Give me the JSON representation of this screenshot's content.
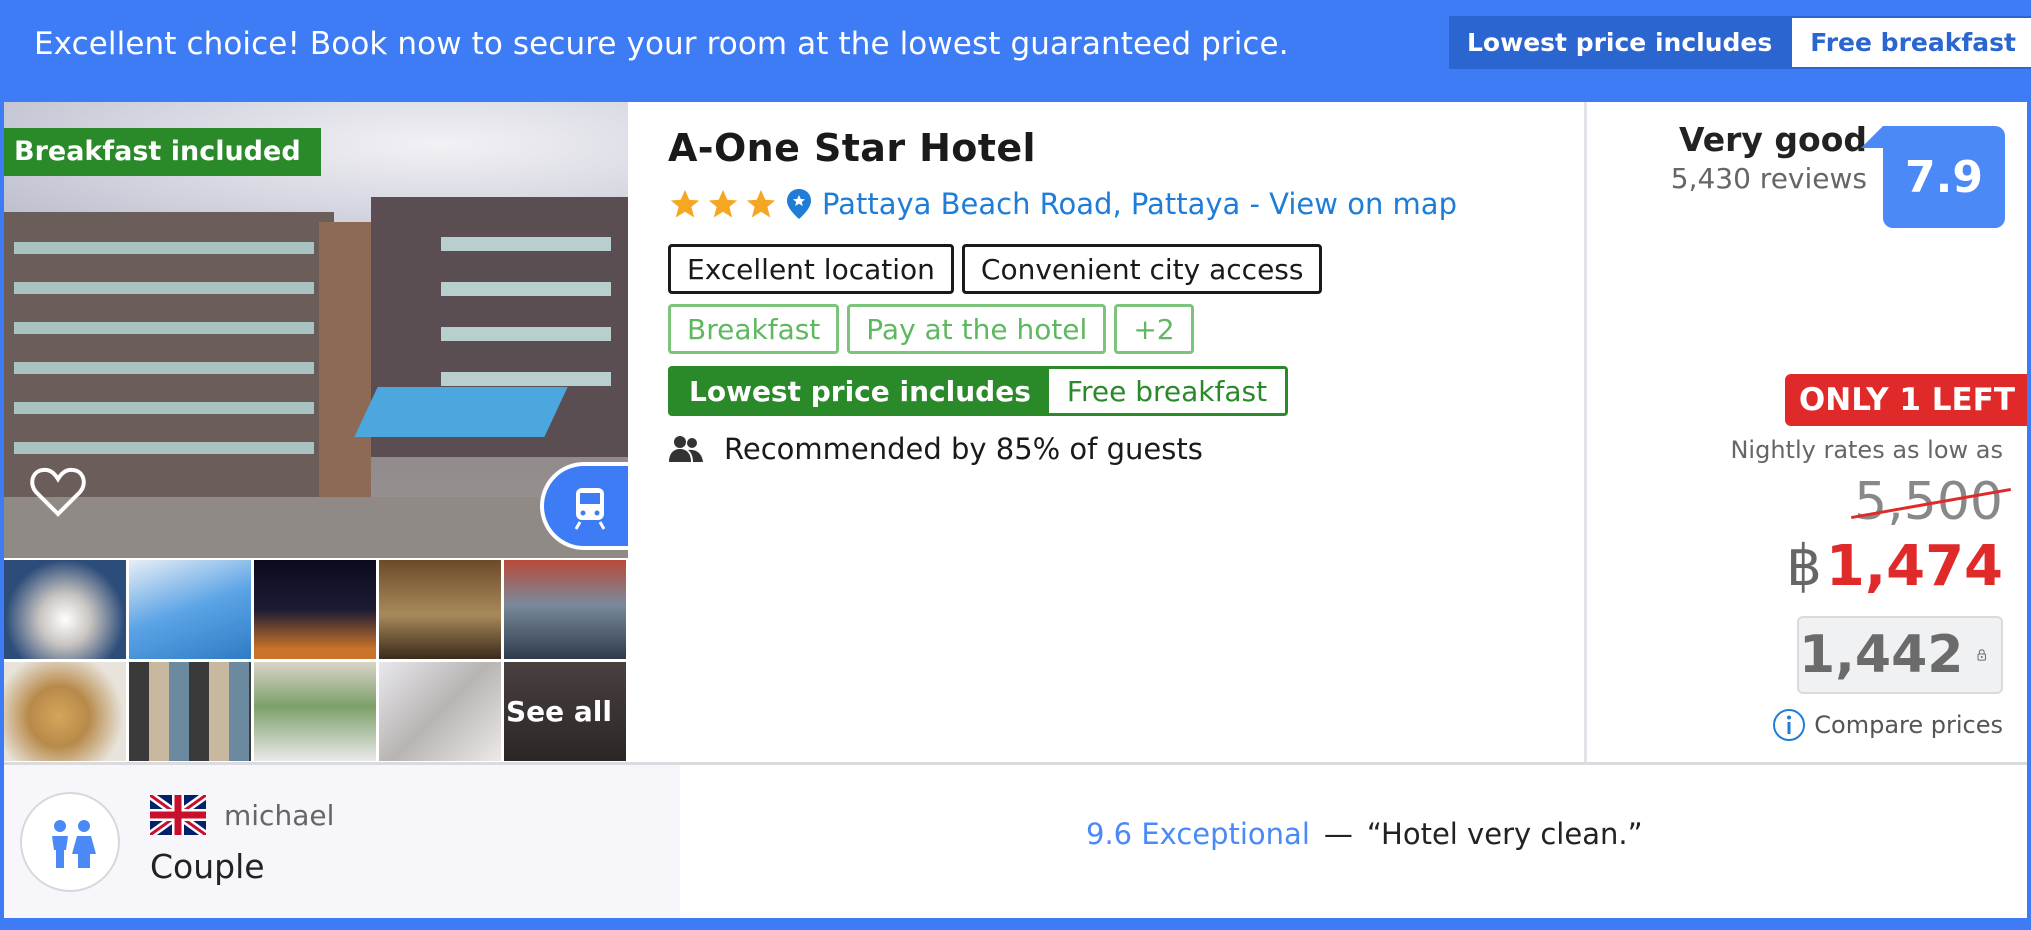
{
  "banner": {
    "message": "Excellent choice! Book now to secure your room at the lowest guaranteed price.",
    "badge_label": "Lowest price includes",
    "badge_value": "Free breakfast"
  },
  "photos": {
    "main_badge": "Breakfast included",
    "see_all": "See all",
    "icons": [
      "heart-icon",
      "train-icon"
    ]
  },
  "hotel": {
    "name": "A-One Star Hotel",
    "star_rating": 3,
    "location_text": "Pattaya Beach Road, Pattaya - View on map",
    "highlights": [
      "Excellent location",
      "Convenient city access"
    ],
    "amenities": [
      "Breakfast",
      "Pay at the hotel",
      "+2"
    ],
    "promo_label": "Lowest price includes",
    "promo_value": "Free breakfast",
    "recommendation": "Recommended by 85% of guests"
  },
  "rating": {
    "label": "Very good",
    "reviews": "5,430 reviews",
    "score": "7.9"
  },
  "pricing": {
    "availability": "ONLY 1 LEFT",
    "nightly_label": "Nightly rates as low as",
    "original_price": "5,500",
    "currency": "฿",
    "current_price": "1,474",
    "member_price": "1,442",
    "compare_label": "Compare prices"
  },
  "review": {
    "reviewer": "michael",
    "traveler_type": "Couple",
    "score_text": "9.6 Exceptional",
    "separator": "—",
    "quote": "“Hotel very clean.”"
  },
  "colors": {
    "brand_blue": "#3d7cf5",
    "green": "#2a8a2a",
    "red": "#e02a2a"
  }
}
